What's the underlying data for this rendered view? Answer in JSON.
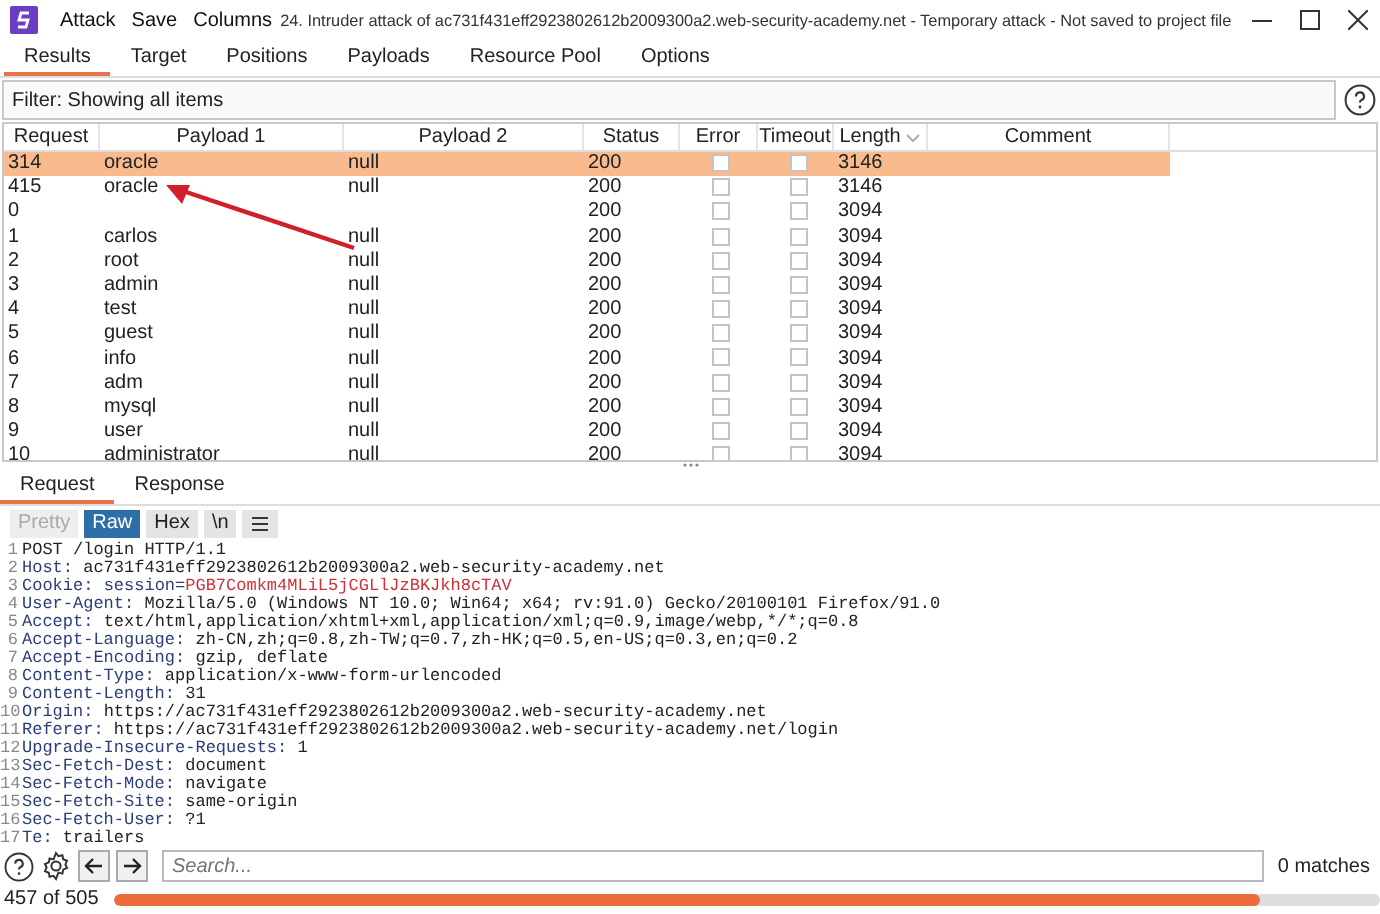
{
  "window": {
    "title": "24. Intruder attack of ac731f431eff2923802612b2009300a2.web-security-academy.net - Temporary attack - Not saved to project file"
  },
  "menu": [
    "Attack",
    "Save",
    "Columns"
  ],
  "tabs": [
    {
      "label": "Results",
      "selected": true
    },
    {
      "label": "Target",
      "selected": false
    },
    {
      "label": "Positions",
      "selected": false
    },
    {
      "label": "Payloads",
      "selected": false
    },
    {
      "label": "Resource Pool",
      "selected": false
    },
    {
      "label": "Options",
      "selected": false
    }
  ],
  "filter": {
    "value": "Filter: Showing all items"
  },
  "table": {
    "columns": [
      "Request",
      "Payload 1",
      "Payload 2",
      "Status",
      "Error",
      "Timeout",
      "Length",
      "Comment"
    ],
    "rows": [
      {
        "request": "314",
        "payload_1": "oracle",
        "payload_2": "null",
        "status": "200",
        "error": false,
        "timeout": false,
        "length": "3146",
        "selected": true
      },
      {
        "request": "415",
        "payload_1": "oracle",
        "payload_2": "null",
        "status": "200",
        "error": false,
        "timeout": false,
        "length": "3146",
        "selected": false
      },
      {
        "request": "0",
        "status": "200",
        "error": false,
        "timeout": false,
        "length": "3094",
        "selected": false
      },
      {
        "request": "1",
        "payload_1": "carlos",
        "payload_2": "null",
        "status": "200",
        "error": false,
        "timeout": false,
        "length": "3094",
        "selected": false
      },
      {
        "request": "2",
        "payload_1": "root",
        "payload_2": "null",
        "status": "200",
        "error": false,
        "timeout": false,
        "length": "3094",
        "selected": false
      },
      {
        "request": "3",
        "payload_1": "admin",
        "payload_2": "null",
        "status": "200",
        "error": false,
        "timeout": false,
        "length": "3094",
        "selected": false
      },
      {
        "request": "4",
        "payload_1": "test",
        "payload_2": "null",
        "status": "200",
        "error": false,
        "timeout": false,
        "length": "3094",
        "selected": false
      },
      {
        "request": "5",
        "payload_1": "guest",
        "payload_2": "null",
        "status": "200",
        "error": false,
        "timeout": false,
        "length": "3094",
        "selected": false
      },
      {
        "request": "6",
        "payload_1": "info",
        "payload_2": "null",
        "status": "200",
        "error": false,
        "timeout": false,
        "length": "3094",
        "selected": false
      },
      {
        "request": "7",
        "payload_1": "adm",
        "payload_2": "null",
        "status": "200",
        "error": false,
        "timeout": false,
        "length": "3094",
        "selected": false
      },
      {
        "request": "8",
        "payload_1": "mysql",
        "payload_2": "null",
        "status": "200",
        "error": false,
        "timeout": false,
        "length": "3094",
        "selected": false
      },
      {
        "request": "9",
        "payload_1": "user",
        "payload_2": "null",
        "status": "200",
        "error": false,
        "timeout": false,
        "length": "3094",
        "selected": false
      },
      {
        "request": "10",
        "payload_1": "administrator",
        "payload_2": "null",
        "status": "200",
        "error": false,
        "timeout": false,
        "length": "3094",
        "selected": false
      }
    ]
  },
  "message_tabs": [
    {
      "label": "Request",
      "selected": true
    },
    {
      "label": "Response",
      "selected": false
    }
  ],
  "view_buttons": [
    {
      "label": "Pretty",
      "selected": false,
      "disabled": true
    },
    {
      "label": "Raw",
      "selected": true,
      "disabled": false
    },
    {
      "label": "Hex",
      "selected": false,
      "disabled": false
    },
    {
      "label": "\\n",
      "selected": false,
      "disabled": false
    }
  ],
  "request_lines": [
    {
      "number": "1",
      "parts": [
        {
          "kind": "plain",
          "text": "POST /login HTTP/1.1"
        }
      ]
    },
    {
      "number": "2",
      "parts": [
        {
          "kind": "key",
          "text": "Host: "
        },
        {
          "kind": "plain",
          "text": "ac731f431eff2923802612b2009300a2.web-security-academy.net"
        }
      ]
    },
    {
      "number": "3",
      "parts": [
        {
          "kind": "key",
          "text": "Cookie: "
        },
        {
          "kind": "cookie",
          "text": "session="
        },
        {
          "kind": "cookie_value",
          "text": "PGB7Comkm4MLiL5jCGLlJzBKJkh8cTAV"
        }
      ]
    },
    {
      "number": "4",
      "parts": [
        {
          "kind": "key",
          "text": "User-Agent: "
        },
        {
          "kind": "plain",
          "text": "Mozilla/5.0 (Windows NT 10.0; Win64; x64; rv:91.0) Gecko/20100101 Firefox/91.0"
        }
      ]
    },
    {
      "number": "5",
      "parts": [
        {
          "kind": "key",
          "text": "Accept: "
        },
        {
          "kind": "plain",
          "text": "text/html,application/xhtml+xml,application/xml;q=0.9,image/webp,*/*;q=0.8"
        }
      ]
    },
    {
      "number": "6",
      "parts": [
        {
          "kind": "key",
          "text": "Accept-Language: "
        },
        {
          "kind": "plain",
          "text": "zh-CN,zh;q=0.8,zh-TW;q=0.7,zh-HK;q=0.5,en-US;q=0.3,en;q=0.2"
        }
      ]
    },
    {
      "number": "7",
      "parts": [
        {
          "kind": "key",
          "text": "Accept-Encoding: "
        },
        {
          "kind": "plain",
          "text": "gzip, deflate"
        }
      ]
    },
    {
      "number": "8",
      "parts": [
        {
          "kind": "key",
          "text": "Content-Type: "
        },
        {
          "kind": "plain",
          "text": "application/x-www-form-urlencoded"
        }
      ]
    },
    {
      "number": "9",
      "parts": [
        {
          "kind": "key",
          "text": "Content-Length: "
        },
        {
          "kind": "plain",
          "text": "31"
        }
      ]
    },
    {
      "number": "10",
      "parts": [
        {
          "kind": "key",
          "text": "Origin: "
        },
        {
          "kind": "plain",
          "text": "https://ac731f431eff2923802612b2009300a2.web-security-academy.net"
        }
      ]
    },
    {
      "number": "11",
      "parts": [
        {
          "kind": "key",
          "text": "Referer: "
        },
        {
          "kind": "plain",
          "text": "https://ac731f431eff2923802612b2009300a2.web-security-academy.net/login"
        }
      ]
    },
    {
      "number": "12",
      "parts": [
        {
          "kind": "key",
          "text": "Upgrade-Insecure-Requests: "
        },
        {
          "kind": "plain",
          "text": "1"
        }
      ]
    },
    {
      "number": "13",
      "parts": [
        {
          "kind": "key",
          "text": "Sec-Fetch-Dest: "
        },
        {
          "kind": "plain",
          "text": "document"
        }
      ]
    },
    {
      "number": "14",
      "parts": [
        {
          "kind": "key",
          "text": "Sec-Fetch-Mode: "
        },
        {
          "kind": "plain",
          "text": "navigate"
        }
      ]
    },
    {
      "number": "15",
      "parts": [
        {
          "kind": "key",
          "text": "Sec-Fetch-Site: "
        },
        {
          "kind": "plain",
          "text": "same-origin"
        }
      ]
    },
    {
      "number": "16",
      "parts": [
        {
          "kind": "key",
          "text": "Sec-Fetch-User: "
        },
        {
          "kind": "plain",
          "text": "?1"
        }
      ]
    },
    {
      "number": "17",
      "parts": [
        {
          "kind": "key",
          "text": "Te: "
        },
        {
          "kind": "plain",
          "text": "trailers"
        }
      ]
    }
  ],
  "search": {
    "placeholder": "Search...",
    "matches": "0 matches"
  },
  "progress": {
    "text": "457 of 505",
    "level": 0.905
  }
}
